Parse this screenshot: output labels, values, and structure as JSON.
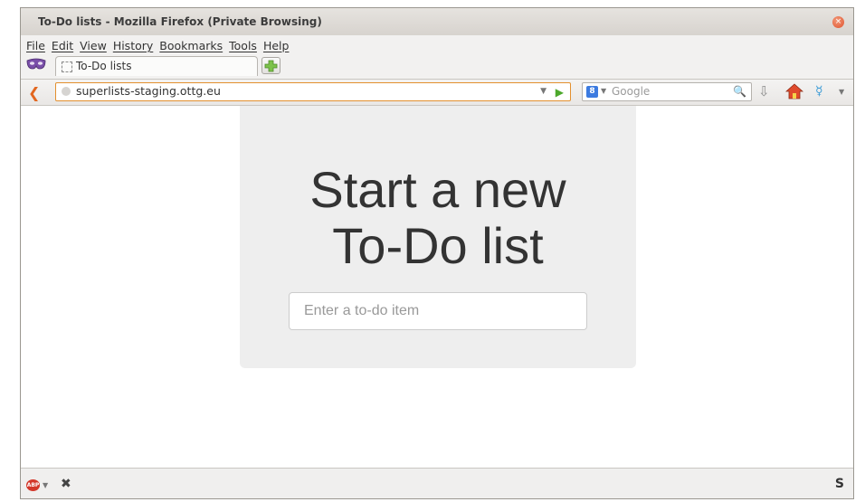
{
  "window": {
    "title": "To-Do lists - Mozilla Firefox (Private Browsing)",
    "close_glyph": "×"
  },
  "menubar": {
    "items": [
      "File",
      "Edit",
      "View",
      "History",
      "Bookmarks",
      "Tools",
      "Help"
    ]
  },
  "tabs": [
    {
      "label": "To-Do lists",
      "active": true
    }
  ],
  "navbar": {
    "back_glyph": "❮",
    "url": "superlists-staging.ottg.eu",
    "dropdown_glyph": "▼",
    "go_glyph": "▶",
    "search_engine_glyph": "8",
    "search_engine_arrow": "▼",
    "search_placeholder": "Google",
    "search_glyph": "🔍",
    "download_glyph": "⇩",
    "ext_glyph": "☿",
    "ext_arrow": "▼"
  },
  "page": {
    "heading_line1": "Start a new",
    "heading_line2": "To-Do list",
    "input_placeholder": "Enter a to-do item"
  },
  "statusbar": {
    "abp_label": "ABP",
    "abp_arrow": "▼",
    "x_glyph": "✖",
    "s_glyph": "S"
  },
  "colors": {
    "accent_orange": "#e2661f",
    "jumbotron_bg": "#eeeeee",
    "heading_text": "#333333"
  },
  "icons": {
    "private_browsing": "mask-icon",
    "tab_favicon": "dotted-page-icon",
    "new_tab": "plus-icon",
    "back": "back-arrow-icon",
    "home": "home-icon",
    "download": "download-arrow-icon",
    "adblock": "abp-stop-icon"
  }
}
